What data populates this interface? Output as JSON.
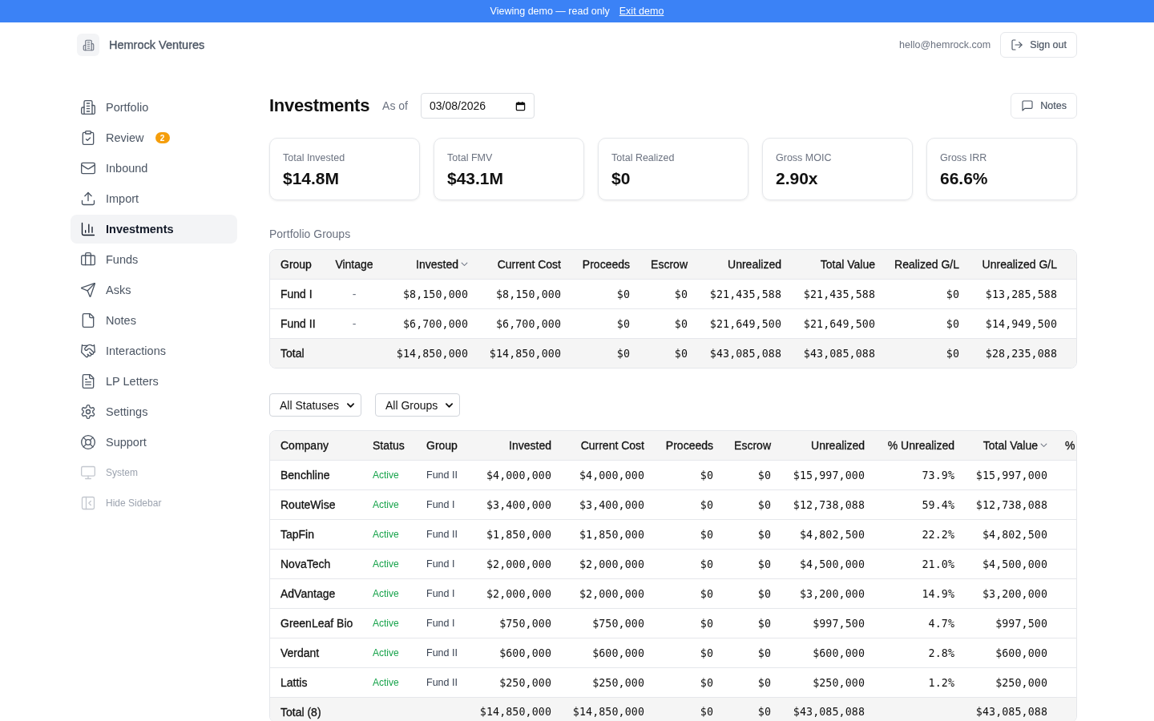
{
  "banner": {
    "message": "Viewing demo — read only",
    "link": "Exit demo"
  },
  "header": {
    "brand": "Hemrock Ventures",
    "email": "hello@hemrock.com",
    "sign_out_button": "Sign out"
  },
  "sidebar": {
    "items": [
      {
        "label": "Portfolio",
        "kind": "nav",
        "selected": false
      },
      {
        "label": "Review",
        "kind": "nav",
        "selected": false,
        "badge": "2"
      },
      {
        "label": "Inbound",
        "kind": "nav",
        "selected": false
      },
      {
        "label": "Import",
        "kind": "nav",
        "selected": false
      },
      {
        "label": "Investments",
        "kind": "nav",
        "selected": true
      },
      {
        "label": "Funds",
        "kind": "nav",
        "selected": false
      },
      {
        "label": "Asks",
        "kind": "nav",
        "selected": false
      },
      {
        "label": "Notes",
        "kind": "nav",
        "selected": false
      },
      {
        "label": "Interactions",
        "kind": "nav",
        "selected": false
      },
      {
        "label": "LP Letters",
        "kind": "nav",
        "selected": false
      },
      {
        "label": "Settings",
        "kind": "nav",
        "selected": false
      },
      {
        "label": "Support",
        "kind": "nav",
        "selected": false
      },
      {
        "label": "System",
        "kind": "utility",
        "selected": false
      },
      {
        "label": "Hide Sidebar",
        "kind": "utility",
        "selected": false
      }
    ]
  },
  "page": {
    "title": "Investments",
    "as_of_label": "As of",
    "as_of_date": "03/08/2026",
    "notes_button": "Notes"
  },
  "stats": [
    {
      "label": "Total Invested",
      "value": "$14.8M"
    },
    {
      "label": "Total FMV",
      "value": "$43.1M"
    },
    {
      "label": "Total Realized",
      "value": "$0"
    },
    {
      "label": "Gross MOIC",
      "value": "2.90x"
    },
    {
      "label": "Gross IRR",
      "value": "66.6%"
    }
  ],
  "portfolio_groups": {
    "title": "Portfolio Groups",
    "columns": [
      {
        "label": "Group",
        "sorted": false
      },
      {
        "label": "Vintage",
        "sorted": false
      },
      {
        "label": "Invested",
        "sorted": true
      },
      {
        "label": "Current Cost",
        "sorted": false
      },
      {
        "label": "Proceeds",
        "sorted": false
      },
      {
        "label": "Escrow",
        "sorted": false
      },
      {
        "label": "Unrealized",
        "sorted": false
      },
      {
        "label": "Total Value",
        "sorted": false
      },
      {
        "label": "Realized G/L",
        "sorted": false
      },
      {
        "label": "Unrealized G/L",
        "sorted": false
      }
    ],
    "rows": [
      {
        "kind": "data",
        "group": "Fund I",
        "vintage": "-",
        "invested": "$8,150,000",
        "current_cost": "$8,150,000",
        "proceeds": "$0",
        "escrow": "$0",
        "unrealized": "$21,435,588",
        "total_value": "$21,435,588",
        "realized_gl": "$0",
        "unrealized_gl": "$13,285,588"
      },
      {
        "kind": "data",
        "group": "Fund II",
        "vintage": "-",
        "invested": "$6,700,000",
        "current_cost": "$6,700,000",
        "proceeds": "$0",
        "escrow": "$0",
        "unrealized": "$21,649,500",
        "total_value": "$21,649,500",
        "realized_gl": "$0",
        "unrealized_gl": "$14,949,500"
      },
      {
        "kind": "total",
        "group": "Total",
        "invested": "$14,850,000",
        "current_cost": "$14,850,000",
        "proceeds": "$0",
        "escrow": "$0",
        "unrealized": "$43,085,088",
        "total_value": "$43,085,088",
        "realized_gl": "$0",
        "unrealized_gl": "$28,235,088"
      }
    ]
  },
  "filters": [
    {
      "value": "All Statuses"
    },
    {
      "value": "All Groups"
    }
  ],
  "investments": {
    "columns": [
      {
        "label": "Company",
        "sorted": false
      },
      {
        "label": "Status",
        "sorted": false
      },
      {
        "label": "Group",
        "sorted": false
      },
      {
        "label": "Invested",
        "sorted": false
      },
      {
        "label": "Current Cost",
        "sorted": false
      },
      {
        "label": "Proceeds",
        "sorted": false
      },
      {
        "label": "Escrow",
        "sorted": false
      },
      {
        "label": "Unrealized",
        "sorted": false
      },
      {
        "label": "% Unrealized",
        "sorted": false
      },
      {
        "label": "Total Value",
        "sorted": true
      },
      {
        "label": "%"
      }
    ],
    "rows": [
      {
        "kind": "data",
        "company": "Benchline",
        "status": "Active",
        "group": "Fund II",
        "invested": "$4,000,000",
        "current_cost": "$4,000,000",
        "proceeds": "$0",
        "escrow": "$0",
        "unrealized": "$15,997,000",
        "pct_unrealized": "73.9%",
        "total_value": "$15,997,000"
      },
      {
        "kind": "data",
        "company": "RouteWise",
        "status": "Active",
        "group": "Fund I",
        "invested": "$3,400,000",
        "current_cost": "$3,400,000",
        "proceeds": "$0",
        "escrow": "$0",
        "unrealized": "$12,738,088",
        "pct_unrealized": "59.4%",
        "total_value": "$12,738,088"
      },
      {
        "kind": "data",
        "company": "TapFin",
        "status": "Active",
        "group": "Fund II",
        "invested": "$1,850,000",
        "current_cost": "$1,850,000",
        "proceeds": "$0",
        "escrow": "$0",
        "unrealized": "$4,802,500",
        "pct_unrealized": "22.2%",
        "total_value": "$4,802,500"
      },
      {
        "kind": "data",
        "company": "NovaTech",
        "status": "Active",
        "group": "Fund I",
        "invested": "$2,000,000",
        "current_cost": "$2,000,000",
        "proceeds": "$0",
        "escrow": "$0",
        "unrealized": "$4,500,000",
        "pct_unrealized": "21.0%",
        "total_value": "$4,500,000"
      },
      {
        "kind": "data",
        "company": "AdVantage",
        "status": "Active",
        "group": "Fund I",
        "invested": "$2,000,000",
        "current_cost": "$2,000,000",
        "proceeds": "$0",
        "escrow": "$0",
        "unrealized": "$3,200,000",
        "pct_unrealized": "14.9%",
        "total_value": "$3,200,000"
      },
      {
        "kind": "data",
        "company": "GreenLeaf Bio",
        "status": "Active",
        "group": "Fund I",
        "invested": "$750,000",
        "current_cost": "$750,000",
        "proceeds": "$0",
        "escrow": "$0",
        "unrealized": "$997,500",
        "pct_unrealized": "4.7%",
        "total_value": "$997,500"
      },
      {
        "kind": "data",
        "company": "Verdant",
        "status": "Active",
        "group": "Fund II",
        "invested": "$600,000",
        "current_cost": "$600,000",
        "proceeds": "$0",
        "escrow": "$0",
        "unrealized": "$600,000",
        "pct_unrealized": "2.8%",
        "total_value": "$600,000"
      },
      {
        "kind": "data",
        "company": "Lattis",
        "status": "Active",
        "group": "Fund II",
        "invested": "$250,000",
        "current_cost": "$250,000",
        "proceeds": "$0",
        "escrow": "$0",
        "unrealized": "$250,000",
        "pct_unrealized": "1.2%",
        "total_value": "$250,000"
      },
      {
        "kind": "total",
        "company": "Total (8)",
        "invested": "$14,850,000",
        "current_cost": "$14,850,000",
        "proceeds": "$0",
        "escrow": "$0",
        "unrealized": "$43,085,088",
        "total_value": "$43,085,088"
      }
    ]
  }
}
